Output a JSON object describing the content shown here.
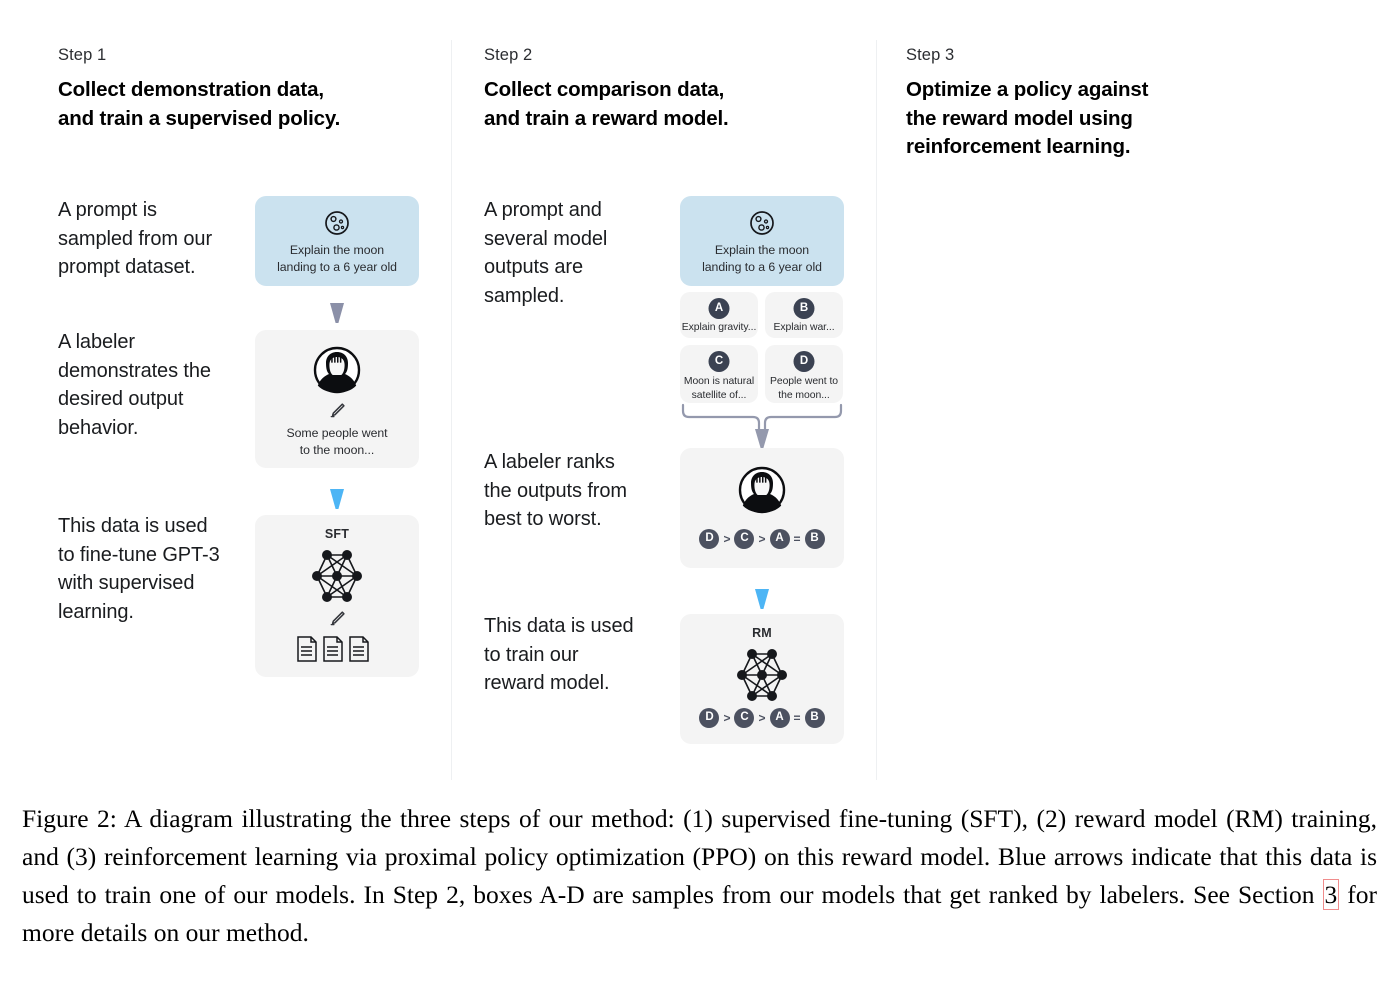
{
  "figure": {
    "caption_prefix": "Figure 2: ",
    "caption_part1": "A diagram illustrating the three steps of our method: (1) supervised fine-tuning (SFT), (2) reward model (RM) training, and (3) reinforcement learning via proximal policy optimization (PPO) on this reward model. Blue arrows indicate that this data is used to train one of our models. In Step 2, boxes A-D are samples from our models that get ranked by labelers. See Section ",
    "caption_ref": "3",
    "caption_part2": " for more details on our method."
  },
  "colors": {
    "prompt_card_bg": "#cbe2ef",
    "grey_card_bg": "#f4f4f4",
    "badge_dark": "#3b4252",
    "arrow_blue": "#4db5f5",
    "arrow_grey": "#8b90a8",
    "divider": "#eef0f2",
    "ref_outline": "#f08c8c"
  },
  "steps": [
    {
      "kicker": "Step 1",
      "title": "Collect demonstration data,\nand train a supervised policy.",
      "paragraphs": [
        "A prompt is\nsampled from our\nprompt dataset.",
        "A labeler\ndemonstrates the\ndesired output\nbehavior.",
        "This data is used\nto fine-tune GPT-3\nwith supervised\nlearning."
      ],
      "cards": {
        "prompt": {
          "icon": "moon-icon",
          "text": "Explain the moon\nlanding to a 6 year old"
        },
        "demo": {
          "icon": "labeler-avatar-icon",
          "pencil": "pencil-icon",
          "text": "Some people went\nto the moon..."
        },
        "sft": {
          "label": "SFT",
          "icon": "neural-network-icon",
          "pencil": "pencil-icon",
          "documents": "documents-icon"
        }
      },
      "arrows": [
        {
          "name": "arrow-prompt-to-demo",
          "color": "grey"
        },
        {
          "name": "arrow-demo-to-sft",
          "color": "blue"
        }
      ]
    },
    {
      "kicker": "Step 2",
      "title": "Collect comparison data,\nand train a reward model.",
      "paragraphs": [
        "A prompt and\nseveral model\noutputs are\nsampled.",
        "A labeler ranks\nthe outputs from\nbest to worst.",
        "This data is used\nto train our\nreward model."
      ],
      "cards": {
        "prompt": {
          "icon": "moon-icon",
          "text": "Explain the moon\nlanding to a 6 year old"
        },
        "samples": [
          {
            "badge": "A",
            "text": "Explain gravity..."
          },
          {
            "badge": "B",
            "text": "Explain war..."
          },
          {
            "badge": "C",
            "text": "Moon is natural\nsatellite of..."
          },
          {
            "badge": "D",
            "text": "People went to\nthe moon..."
          }
        ],
        "ranking": {
          "icon": "labeler-avatar-icon",
          "order": [
            "D",
            ">",
            "C",
            ">",
            "A",
            "=",
            "B"
          ]
        },
        "rm": {
          "label": "RM",
          "icon": "neural-network-icon",
          "order": [
            "D",
            ">",
            "C",
            ">",
            "A",
            "=",
            "B"
          ]
        }
      },
      "arrows": [
        {
          "name": "arrow-samples-to-ranking",
          "color": "grey"
        },
        {
          "name": "arrow-ranking-to-rm",
          "color": "blue"
        }
      ]
    },
    {
      "kicker": "Step 3",
      "title": "Optimize a policy against\nthe reward model using\nreinforcement learning.",
      "paragraphs": [],
      "cards": {},
      "arrows": []
    }
  ]
}
